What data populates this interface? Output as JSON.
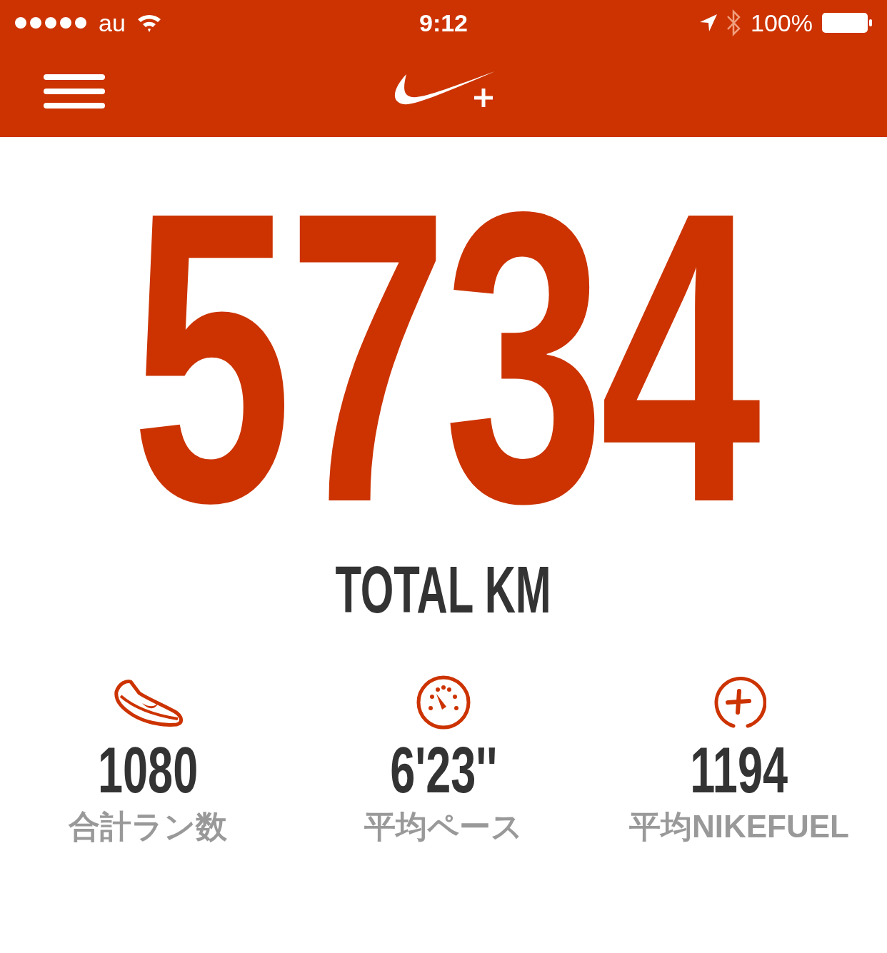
{
  "status_bar": {
    "carrier": "au",
    "time": "9:12",
    "battery": "100%"
  },
  "total": {
    "value": "5734",
    "label": "TOTAL KM"
  },
  "stats": [
    {
      "kind": "shoe",
      "value": "1080",
      "label": "合計ラン数"
    },
    {
      "kind": "gauge",
      "value": "6'23''",
      "label": "平均ペース"
    },
    {
      "kind": "fuel",
      "value": "1194",
      "label": "平均NIKEFUEL"
    }
  ]
}
